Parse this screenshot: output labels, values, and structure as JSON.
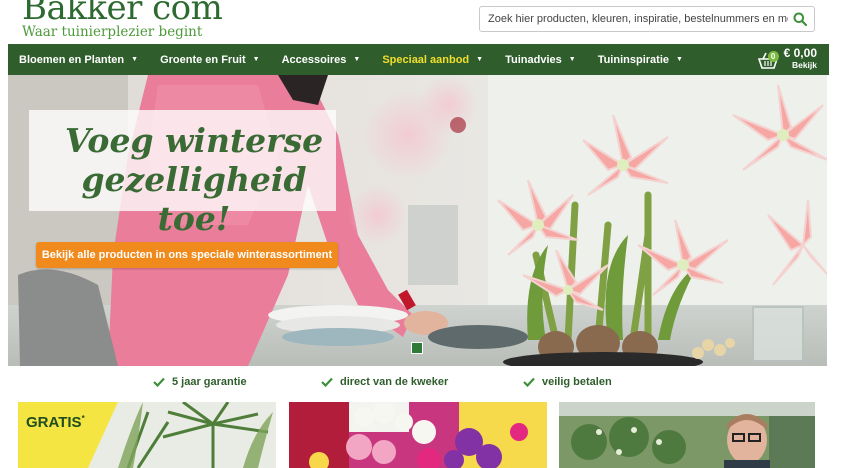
{
  "header": {
    "logo_name": "Bakker com",
    "logo_tagline": "Waar tuinierplezier begint",
    "search_placeholder": "Zoek hier producten, kleuren, inspiratie, bestelnummers en meer"
  },
  "nav": {
    "items": [
      {
        "label": "Bloemen en Planten"
      },
      {
        "label": "Groente en Fruit"
      },
      {
        "label": "Accessoires"
      },
      {
        "label": "Speciaal aanbod"
      },
      {
        "label": "Tuinadvies"
      },
      {
        "label": "Tuininspiratie"
      }
    ],
    "cart": {
      "count": "0",
      "amount": "€ 0,00",
      "label": "Bekijk"
    }
  },
  "hero": {
    "headline_line1": "Voeg winterse",
    "headline_line2": "gezelligheid toe!",
    "cta_label": "Bekijk alle producten in ons speciale winterassortiment"
  },
  "usps": [
    {
      "label": "5 jaar garantie"
    },
    {
      "label": "direct van de kweker"
    },
    {
      "label": "veilig betalen"
    }
  ],
  "tiles": {
    "gratis_label": "GRATIS",
    "gratis_mark": "*"
  },
  "colors": {
    "nav_bg": "#2f5e2c",
    "special_item": "#f2df2c",
    "cta": "#f08a1c",
    "brand_green": "#2d6a30",
    "cart_badge": "#7dbb3e"
  }
}
